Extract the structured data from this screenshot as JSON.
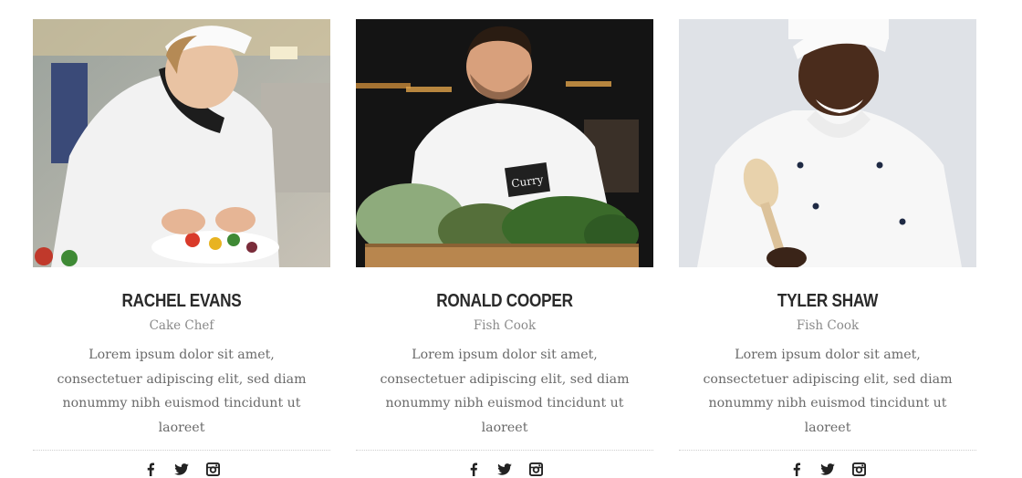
{
  "team": [
    {
      "name": "RACHEL EVANS",
      "role": "Cake Chef",
      "bio": "Lorem ipsum dolor sit amet, consectetuer adipiscing elit, sed diam nonummy nibh euismod tincidunt ut laoreet",
      "photo": "chef-plating-dish-photo"
    },
    {
      "name": "RONALD COOPER",
      "role": "Fish Cook",
      "bio": "Lorem ipsum dolor sit amet, consectetuer adipiscing elit, sed diam nonummy nibh euismod tincidunt ut laoreet",
      "photo": "chef-holding-herbs-photo",
      "sign_text": "Curry"
    },
    {
      "name": "TYLER SHAW",
      "role": "Fish Cook",
      "bio": "Lorem ipsum dolor sit amet, consectetuer adipiscing elit, sed diam nonummy nibh euismod tincidunt ut laoreet",
      "photo": "chef-with-wooden-spoon-photo"
    }
  ],
  "social_icons": [
    "facebook-icon",
    "twitter-icon",
    "instagram-icon"
  ],
  "colors": {
    "name": "#2a2a2a",
    "role": "#8a8a8a",
    "bio": "#6a6a6a",
    "icon": "#222222",
    "divider": "#cfcfcf"
  }
}
